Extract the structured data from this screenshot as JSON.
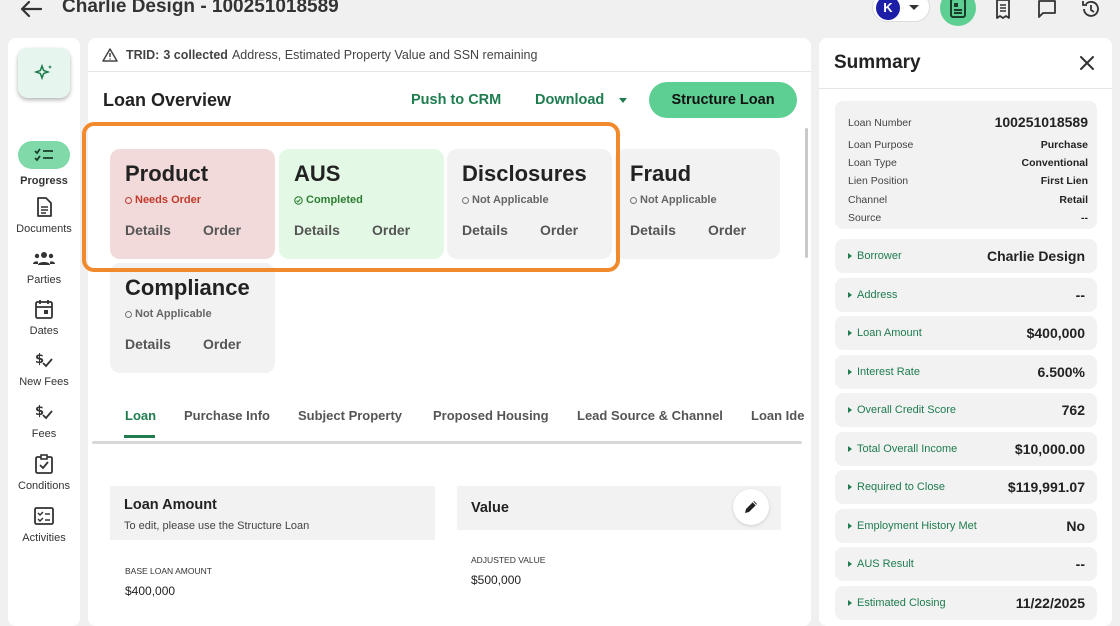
{
  "header": {
    "title": "Charlie Design - 100251018589",
    "avatar_initial": "K"
  },
  "nav": {
    "items": [
      {
        "label": "Progress",
        "icon": "progress-icon"
      },
      {
        "label": "Documents",
        "icon": "document-icon"
      },
      {
        "label": "Parties",
        "icon": "parties-icon"
      },
      {
        "label": "Dates",
        "icon": "calendar-icon"
      },
      {
        "label": "New Fees",
        "icon": "fees-icon"
      },
      {
        "label": "Fees",
        "icon": "fees-icon"
      },
      {
        "label": "Conditions",
        "icon": "clipboard-check-icon"
      },
      {
        "label": "Activities",
        "icon": "activities-icon"
      }
    ]
  },
  "banner": {
    "prefix": "TRID:",
    "count": "3 collected",
    "text": "Address, Estimated Property Value and SSN remaining"
  },
  "overview": {
    "title": "Loan Overview",
    "push_label": "Push to CRM",
    "download_label": "Download",
    "structure_label": "Structure Loan"
  },
  "cards": [
    {
      "title": "Product",
      "status": "Needs Order",
      "details": "Details",
      "order": "Order"
    },
    {
      "title": "AUS",
      "status": "Completed",
      "details": "Details",
      "order": "Order"
    },
    {
      "title": "Disclosures",
      "status": "Not Applicable",
      "details": "Details",
      "order": "Order"
    },
    {
      "title": "Fraud",
      "status": "Not Applicable",
      "details": "Details",
      "order": "Order"
    },
    {
      "title": "Compliance",
      "status": "Not Applicable",
      "details": "Details",
      "order": "Order"
    }
  ],
  "colors": {
    "accent": "#1e7c4f",
    "primary_button": "#5dcf92",
    "highlight": "#f08a2c",
    "needs_order_bg": "#f2dada",
    "needs_order_text": "#c0392b",
    "completed_bg": "#e3f9e5",
    "completed_text": "#2e7d32"
  },
  "tabs": [
    "Loan",
    "Purchase Info",
    "Subject Property",
    "Proposed Housing",
    "Lead Source & Channel",
    "Loan Ide"
  ],
  "loan_amount_section": {
    "title": "Loan Amount",
    "subtitle": "To edit, please use the Structure Loan",
    "field_label": "BASE LOAN AMOUNT",
    "field_value": "$400,000"
  },
  "value_section": {
    "title": "Value",
    "field_label": "ADJUSTED VALUE",
    "field_value": "$500,000"
  },
  "summary": {
    "title": "Summary",
    "loan_number_label": "Loan Number",
    "loan_number": "100251018589",
    "rows": [
      {
        "label": "Loan Purpose",
        "value": "Purchase"
      },
      {
        "label": "Loan Type",
        "value": "Conventional"
      },
      {
        "label": "Lien Position",
        "value": "First Lien"
      },
      {
        "label": "Channel",
        "value": "Retail"
      },
      {
        "label": "Source",
        "value": "--"
      }
    ],
    "items": [
      {
        "label": "Borrower",
        "value": "Charlie Design"
      },
      {
        "label": "Address",
        "value": "--"
      },
      {
        "label": "Loan Amount",
        "value": "$400,000"
      },
      {
        "label": "Interest Rate",
        "value": "6.500%"
      },
      {
        "label": "Overall Credit Score",
        "value": "762"
      },
      {
        "label": "Total Overall Income",
        "value": "$10,000.00"
      },
      {
        "label": "Required to Close",
        "value": "$119,991.07"
      },
      {
        "label": "Employment History Met",
        "value": "No"
      },
      {
        "label": "AUS Result",
        "value": "--"
      },
      {
        "label": "Estimated Closing",
        "value": "11/22/2025"
      }
    ]
  }
}
